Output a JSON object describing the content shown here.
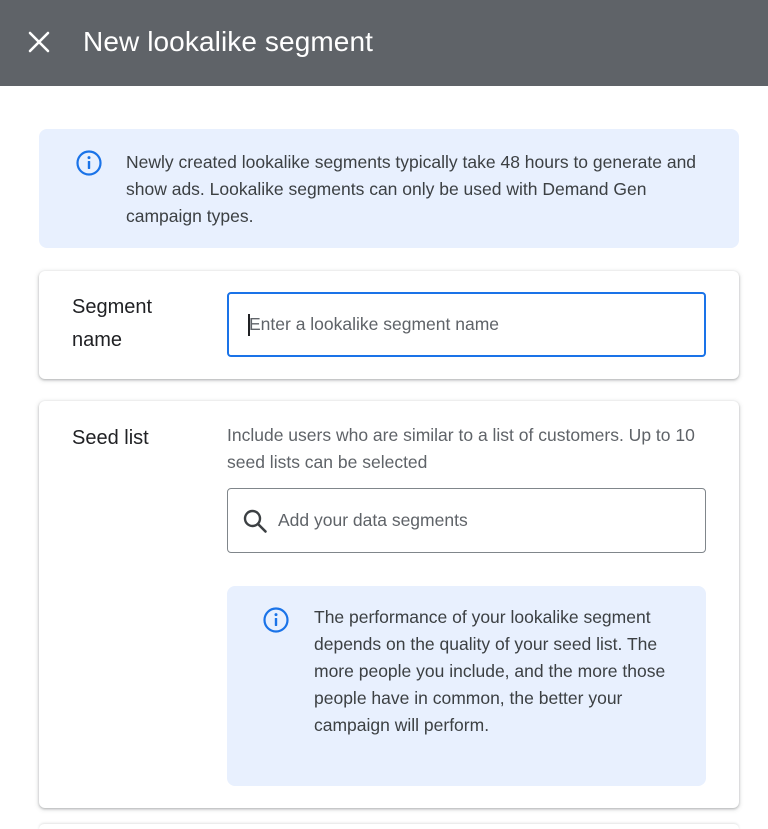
{
  "header": {
    "title": "New lookalike segment",
    "close_icon": "close-icon"
  },
  "banner": {
    "icon": "info-icon",
    "text": "Newly created lookalike segments typically take 48 hours to generate and show ads. Lookalike segments can only be used with Demand Gen campaign types."
  },
  "segment_name": {
    "label": "Segment name",
    "placeholder": "Enter a lookalike segment name",
    "value": ""
  },
  "seed_list": {
    "label": "Seed list",
    "description": "Include users who are similar to a list of customers. Up to 10 seed lists can be selected",
    "search_placeholder": "Add your data segments",
    "search_icon": "search-icon",
    "tip_icon": "info-icon",
    "tip_text": "The performance of your lookalike segment depends on the quality of your seed list. The more people you include, and the more those people have in common, the better your campaign will perform."
  },
  "colors": {
    "header_bg": "#5f6368",
    "accent": "#1a73e8",
    "info_bg": "#e8f0fe",
    "info_icon": "#1a73e8"
  }
}
